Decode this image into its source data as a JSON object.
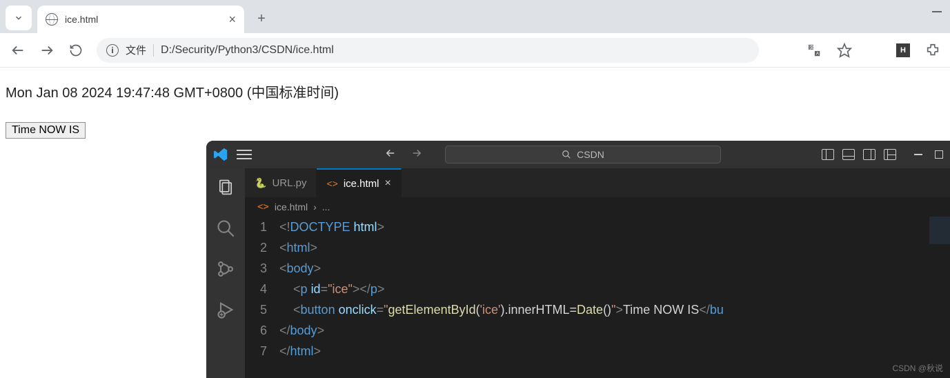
{
  "browser": {
    "tab_title": "ice.html",
    "newtab": "+",
    "url_label": "文件",
    "url": "D:/Security/Python3/CSDN/ice.html"
  },
  "page": {
    "timestamp": "Mon Jan 08 2024 19:47:48 GMT+0800 (中国标准时间)",
    "button_label": "Time NOW IS"
  },
  "vscode": {
    "search": "CSDN",
    "tabs": [
      {
        "icon": "python",
        "label": "URL.py",
        "active": false
      },
      {
        "icon": "html",
        "label": "ice.html",
        "active": true
      }
    ],
    "breadcrumb": {
      "file": "ice.html",
      "sep": "›",
      "more": "..."
    },
    "code": {
      "lines": [
        {
          "n": "1",
          "html": "<span class='tk-punct'>&lt;!</span><span class='tk-doc'>DOCTYPE</span> <span class='tk-attr'>html</span><span class='tk-punct'>&gt;</span>"
        },
        {
          "n": "2",
          "html": "<span class='tk-punct'>&lt;</span><span class='tk-tag'>html</span><span class='tk-punct'>&gt;</span>"
        },
        {
          "n": "3",
          "html": "<span class='tk-punct'>&lt;</span><span class='tk-tag'>body</span><span class='tk-punct'>&gt;</span>"
        },
        {
          "n": "4",
          "html": "    <span class='tk-punct'>&lt;</span><span class='tk-tag'>p</span> <span class='tk-attr'>id</span><span class='tk-punct'>=</span><span class='tk-str'>\"ice\"</span><span class='tk-punct'>&gt;&lt;/</span><span class='tk-tag'>p</span><span class='tk-punct'>&gt;</span>"
        },
        {
          "n": "5",
          "html": "    <span class='tk-punct'>&lt;</span><span class='tk-tag'>button</span> <span class='tk-attr'>onclick</span><span class='tk-punct'>=</span><span class='tk-str'>\"</span><span class='tk-fn'>getElementById</span><span class='tk-txt'>(</span><span class='tk-str'>'ice'</span><span class='tk-txt'>).innerHTML=</span><span class='tk-fn'>Date</span><span class='tk-txt'>()</span><span class='tk-str'>\"</span><span class='tk-punct'>&gt;</span><span class='tk-txt'>Time NOW IS</span><span class='tk-punct'>&lt;/</span><span class='tk-tag'>bu</span>"
        },
        {
          "n": "6",
          "html": "<span class='tk-punct'>&lt;/</span><span class='tk-tag'>body</span><span class='tk-punct'>&gt;</span>"
        },
        {
          "n": "7",
          "html": "<span class='tk-punct'>&lt;/</span><span class='tk-tag'>html</span><span class='tk-punct'>&gt;</span>"
        }
      ]
    }
  },
  "watermark": "CSDN @秋说"
}
